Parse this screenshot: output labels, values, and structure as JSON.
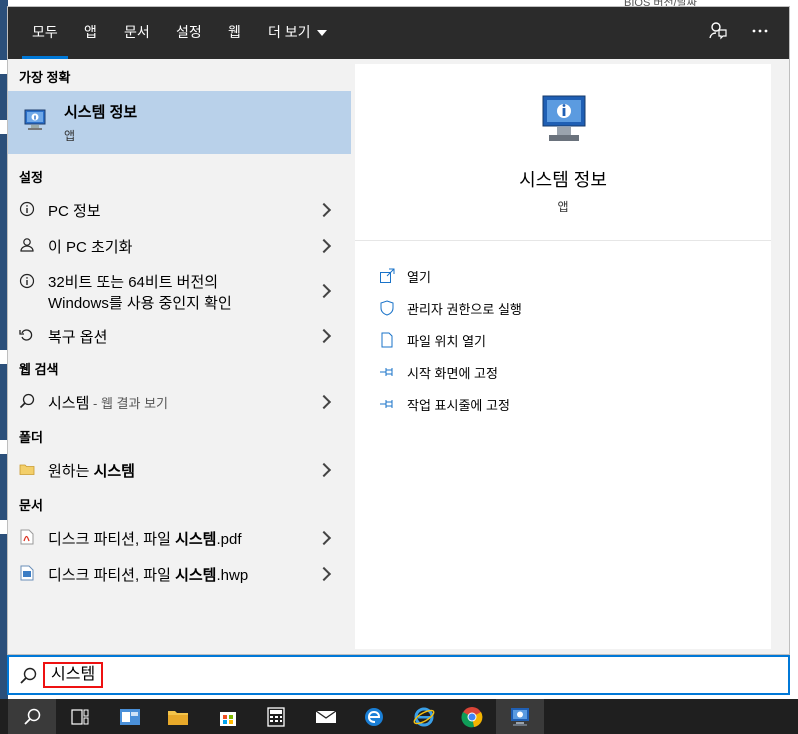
{
  "background": {
    "topright_text": "BIOS 버전/날짜"
  },
  "tabs": [
    {
      "label": "모두",
      "active": true
    },
    {
      "label": "앱"
    },
    {
      "label": "문서"
    },
    {
      "label": "설정"
    },
    {
      "label": "웹"
    },
    {
      "label": "더 보기"
    }
  ],
  "top_icons": [
    "feedback-icon",
    "more-options-icon"
  ],
  "results": {
    "best_match_header": "가장 정확",
    "best_match": {
      "title": "시스템 정보",
      "subtitle": "앱"
    },
    "settings_header": "설정",
    "settings": [
      {
        "label": "PC 정보",
        "icon": "info-icon"
      },
      {
        "label": "이 PC 초기화",
        "icon": "reset-icon"
      },
      {
        "label_line1": "32비트 또는 64비트 버전의",
        "label_line2": "Windows를 사용 중인지 확인",
        "icon": "info-icon"
      },
      {
        "label": "복구 옵션",
        "icon": "recovery-icon"
      }
    ],
    "web_header": "웹 검색",
    "web": {
      "query": "시스템",
      "suffix": " - 웹 결과 보기"
    },
    "folder_header": "폴더",
    "folder": {
      "prefix": "원하는 ",
      "bold": "시스템"
    },
    "docs_header": "문서",
    "docs": [
      {
        "prefix": "디스크 파티션, 파일 ",
        "bold": "시스템",
        "ext": ".pdf",
        "icon": "pdf-icon"
      },
      {
        "prefix": "디스크 파티션, 파일 ",
        "bold": "시스템",
        "ext": ".hwp",
        "icon": "hwp-doc-icon"
      }
    ]
  },
  "detail": {
    "title": "시스템 정보",
    "subtitle": "앱",
    "actions": [
      {
        "label": "열기",
        "icon": "open-icon"
      },
      {
        "label": "관리자 권한으로 실행",
        "icon": "shield-icon"
      },
      {
        "label": "파일 위치 열기",
        "icon": "file-location-icon"
      },
      {
        "label": "시작 화면에 고정",
        "icon": "pin-icon"
      },
      {
        "label": "작업 표시줄에 고정",
        "icon": "pin-icon"
      }
    ]
  },
  "search": {
    "query": "시스템"
  },
  "taskbar": [
    "search-icon",
    "task-view-icon",
    "outlook-icon",
    "file-explorer-icon",
    "store-icon",
    "calculator-icon",
    "mail-icon",
    "edge-icon",
    "internet-explorer-icon",
    "chrome-icon",
    "system-info-icon"
  ],
  "colors": {
    "accent": "#0078d7",
    "selected": "#b9d1ea",
    "topbar": "#2b2b2b",
    "taskbar": "#1f1f1f",
    "highlight_border": "#ee1111"
  }
}
